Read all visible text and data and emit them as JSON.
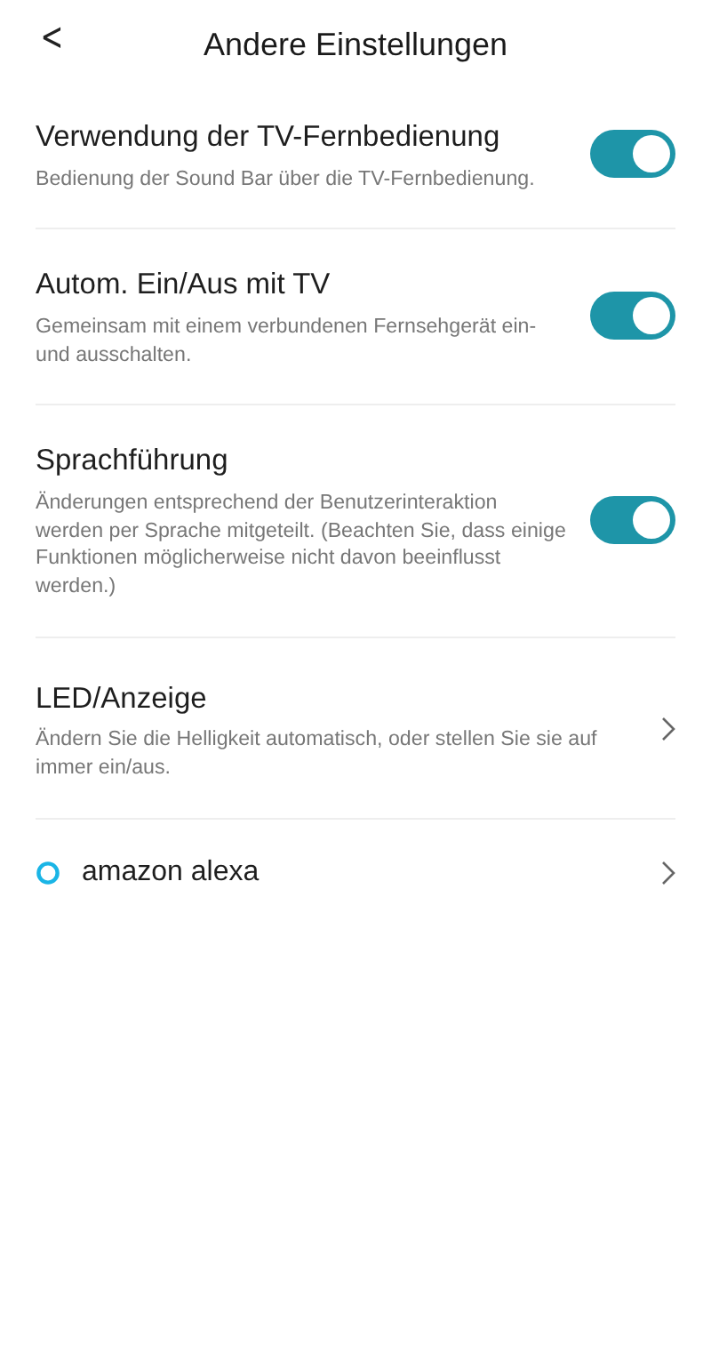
{
  "header": {
    "back": "<",
    "title": "Andere Einstellungen"
  },
  "settings": [
    {
      "kind": "toggle",
      "title": "Verwendung der TV-Fernbedienung",
      "description": "Bedienung der Sound Bar über die TV-Fernbedienung.",
      "on": true
    },
    {
      "kind": "toggle",
      "title": "Autom. Ein/Aus mit TV",
      "description": "Gemeinsam mit einem verbundenen Fernsehgerät ein- und ausschalten.",
      "on": true
    },
    {
      "kind": "toggle",
      "title": "Sprachführung",
      "description": "Änderungen entsprechend der Benutzerinteraktion werden per Sprache mitgeteilt. (Beachten Sie, dass einige Funktionen möglicherweise nicht davon beeinflusst werden.)",
      "on": true
    },
    {
      "kind": "link",
      "title": "LED/Anzeige",
      "description": "Ändern Sie die Helligkeit automatisch, oder stellen Sie sie auf immer ein/aus."
    },
    {
      "kind": "alexa",
      "title": "amazon alexa"
    }
  ]
}
